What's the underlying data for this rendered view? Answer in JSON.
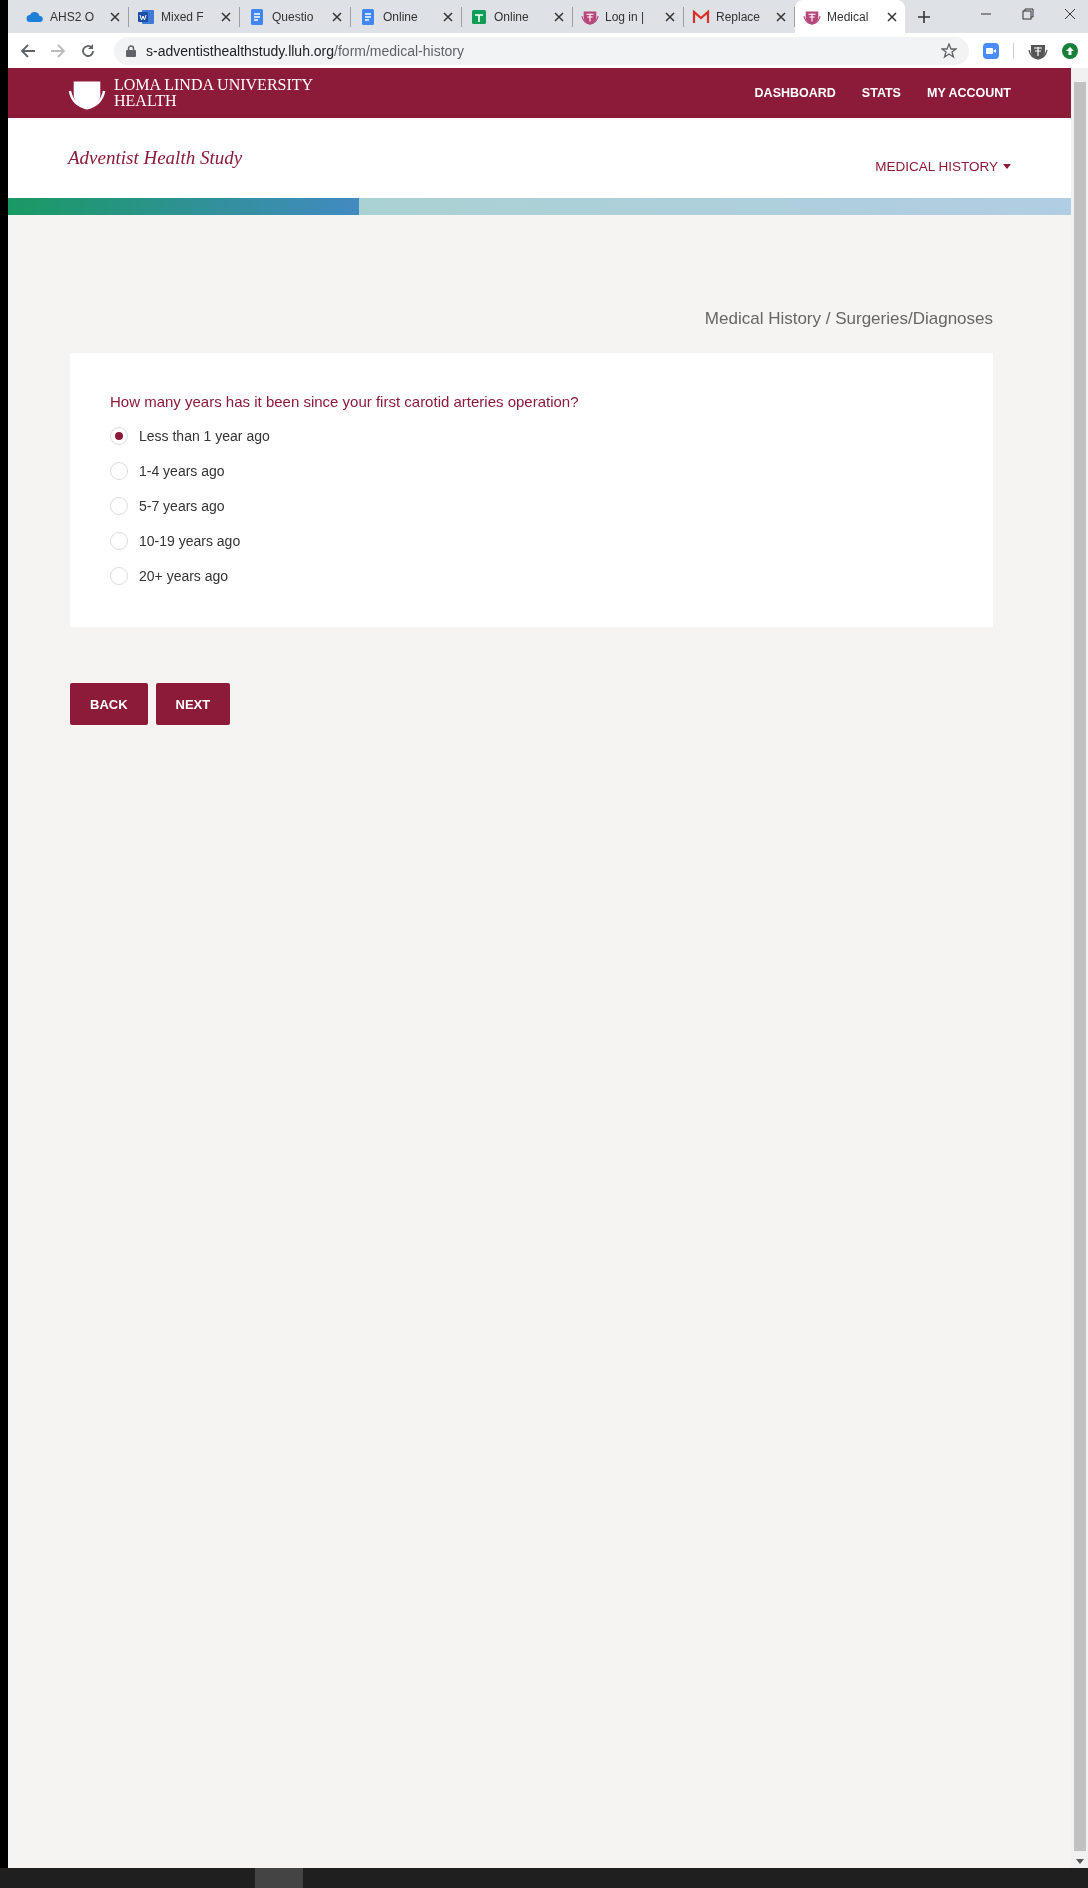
{
  "browser": {
    "tabs": [
      {
        "title": "AHS2 O",
        "kind": "cloud",
        "selected": false
      },
      {
        "title": "Mixed F",
        "kind": "word",
        "selected": false
      },
      {
        "title": "Questio",
        "kind": "docs",
        "selected": false
      },
      {
        "title": "Online",
        "kind": "docs",
        "selected": false
      },
      {
        "title": "Online",
        "kind": "sheets",
        "selected": false
      },
      {
        "title": "Log in |",
        "kind": "crest",
        "selected": false
      },
      {
        "title": "Replace",
        "kind": "mail",
        "selected": false
      },
      {
        "title": "Medical",
        "kind": "crest",
        "selected": true
      }
    ],
    "url_host": "s-adventisthealthstudy.lluh.org",
    "url_path": "/form/medical-history"
  },
  "site": {
    "brand": "LOMA LINDA UNIVERSITY HEALTH",
    "nav": [
      "DASHBOARD",
      "STATS",
      "MY ACCOUNT"
    ],
    "study_title": "Adventist Health Study",
    "section_menu": "MEDICAL HISTORY",
    "progress": {
      "level": 0.33
    }
  },
  "breadcrumb": "Medical History / Surgeries/Diagnoses",
  "question": {
    "text": "How many years has it been since your first carotid arteries operation?",
    "options": [
      {
        "label": "Less than 1 year ago",
        "selected": true
      },
      {
        "label": "1-4 years ago",
        "selected": false
      },
      {
        "label": "5-7 years ago",
        "selected": false
      },
      {
        "label": "10-19 years ago",
        "selected": false
      },
      {
        "label": "20+ years ago",
        "selected": false
      }
    ]
  },
  "buttons": [
    "BACK",
    "NEXT"
  ]
}
